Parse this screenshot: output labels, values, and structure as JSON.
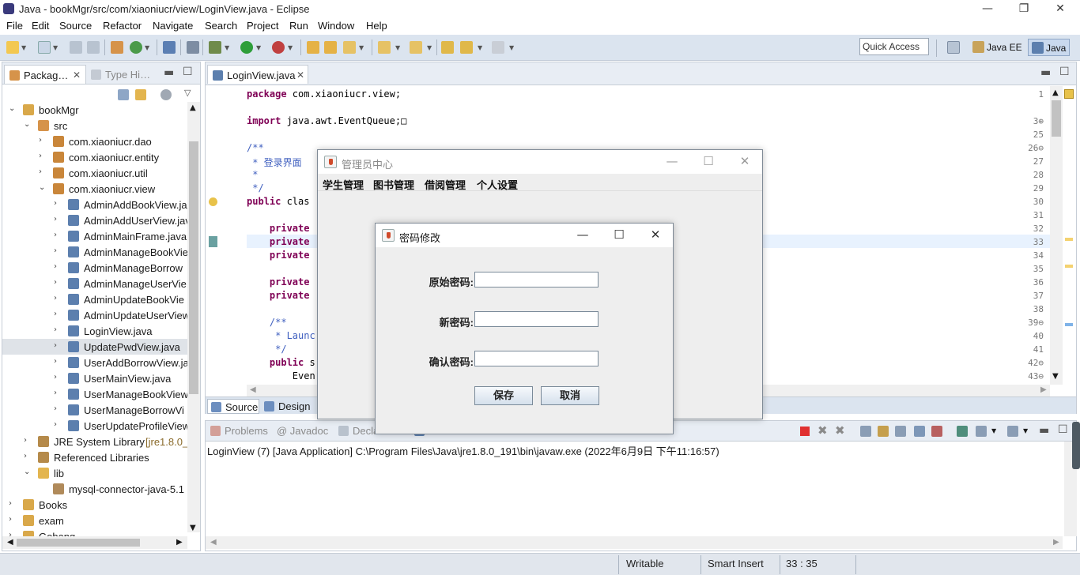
{
  "window": {
    "title": "Java - bookMgr/src/com/xiaoniucr/view/LoginView.java - Eclipse",
    "minimize": "—",
    "restore": "❐",
    "close": "✕"
  },
  "menubar": {
    "items": [
      "File",
      "Edit",
      "Source",
      "Refactor",
      "Navigate",
      "Search",
      "Project",
      "Run",
      "Window",
      "Help"
    ]
  },
  "toolbar": {
    "quick_access": "Quick Access",
    "perspectives": [
      "Java EE",
      "Java"
    ]
  },
  "package_explorer": {
    "tabs": [
      "Packag…",
      "Type Hi…"
    ],
    "tree": [
      {
        "label": "bookMgr",
        "level": 0,
        "twisty": "open",
        "icon": "project-icon"
      },
      {
        "label": "src",
        "level": 1,
        "twisty": "open",
        "icon": "source-folder-icon"
      },
      {
        "label": "com.xiaoniucr.dao",
        "level": 2,
        "twisty": "closed",
        "icon": "package-icon"
      },
      {
        "label": "com.xiaoniucr.entity",
        "level": 2,
        "twisty": "closed",
        "icon": "package-icon"
      },
      {
        "label": "com.xiaoniucr.util",
        "level": 2,
        "twisty": "closed",
        "icon": "package-icon"
      },
      {
        "label": "com.xiaoniucr.view",
        "level": 2,
        "twisty": "open",
        "icon": "package-icon"
      },
      {
        "label": "AdminAddBookView.ja",
        "level": 3,
        "twisty": "closed",
        "icon": "java-file-icon"
      },
      {
        "label": "AdminAddUserView.jav",
        "level": 3,
        "twisty": "closed",
        "icon": "java-file-icon"
      },
      {
        "label": "AdminMainFrame.java",
        "level": 3,
        "twisty": "closed",
        "icon": "java-file-icon"
      },
      {
        "label": "AdminManageBookVie",
        "level": 3,
        "twisty": "closed",
        "icon": "java-file-icon"
      },
      {
        "label": "AdminManageBorrow",
        "level": 3,
        "twisty": "closed",
        "icon": "java-file-icon"
      },
      {
        "label": "AdminManageUserVie",
        "level": 3,
        "twisty": "closed",
        "icon": "java-file-icon"
      },
      {
        "label": "AdminUpdateBookVie",
        "level": 3,
        "twisty": "closed",
        "icon": "java-file-icon"
      },
      {
        "label": "AdminUpdateUserView",
        "level": 3,
        "twisty": "closed",
        "icon": "java-file-icon"
      },
      {
        "label": "LoginView.java",
        "level": 3,
        "twisty": "closed",
        "icon": "java-file-icon"
      },
      {
        "label": "UpdatePwdView.java",
        "level": 3,
        "twisty": "closed",
        "icon": "java-file-icon",
        "selected": true
      },
      {
        "label": "UserAddBorrowView.ja",
        "level": 3,
        "twisty": "closed",
        "icon": "java-file-icon"
      },
      {
        "label": "UserMainView.java",
        "level": 3,
        "twisty": "closed",
        "icon": "java-file-icon"
      },
      {
        "label": "UserManageBookView",
        "level": 3,
        "twisty": "closed",
        "icon": "java-file-icon"
      },
      {
        "label": "UserManageBorrowVi",
        "level": 3,
        "twisty": "closed",
        "icon": "java-file-icon"
      },
      {
        "label": "UserUpdateProfileView",
        "level": 3,
        "twisty": "closed",
        "icon": "java-file-icon"
      },
      {
        "label": "JRE System Library",
        "decoration": "[jre1.8.0_",
        "level": 1,
        "twisty": "closed",
        "icon": "library-icon"
      },
      {
        "label": "Referenced Libraries",
        "level": 1,
        "twisty": "closed",
        "icon": "library-icon"
      },
      {
        "label": "lib",
        "level": 1,
        "twisty": "open",
        "icon": "folder-icon"
      },
      {
        "label": "mysql-connector-java-5.1",
        "level": 2,
        "twisty": "none",
        "icon": "jar-icon"
      },
      {
        "label": "Books",
        "level": 0,
        "twisty": "closed",
        "icon": "project-icon"
      },
      {
        "label": "exam",
        "level": 0,
        "twisty": "closed",
        "icon": "project-icon"
      },
      {
        "label": "Gobang",
        "level": 0,
        "twisty": "closed",
        "icon": "project-icon"
      }
    ]
  },
  "editor": {
    "tab": "LoginView.java",
    "bottom_tabs": [
      "Source",
      "Design"
    ],
    "lines": [
      {
        "n": "1",
        "text": "package com.xiaoniucr.view;",
        "kind": "pkg"
      },
      {
        "n": "",
        "text": "",
        "kind": "blank"
      },
      {
        "n": "3⊕",
        "text": "import java.awt.EventQueue;□",
        "kind": "imp"
      },
      {
        "n": "25",
        "text": "",
        "kind": "blank"
      },
      {
        "n": "26⊖",
        "text": "/**",
        "kind": "cm"
      },
      {
        "n": "27",
        "text": " * 登录界面",
        "kind": "cm"
      },
      {
        "n": "28",
        "text": " *",
        "kind": "cm"
      },
      {
        "n": "29",
        "text": " */",
        "kind": "cm"
      },
      {
        "n": "30",
        "text": "public clas",
        "kind": "pub"
      },
      {
        "n": "31",
        "text": "",
        "kind": "blank"
      },
      {
        "n": "32",
        "text": "    private",
        "kind": "kw"
      },
      {
        "n": "33",
        "text": "    private",
        "kind": "kw"
      },
      {
        "n": "34",
        "text": "    private",
        "kind": "kw"
      },
      {
        "n": "35",
        "text": "",
        "kind": "blank"
      },
      {
        "n": "36",
        "text": "    private",
        "kind": "kw"
      },
      {
        "n": "37",
        "text": "    private",
        "kind": "kw"
      },
      {
        "n": "38",
        "text": "",
        "kind": "blank"
      },
      {
        "n": "39⊖",
        "text": "    /**",
        "kind": "cm"
      },
      {
        "n": "40",
        "text": "     * Launc",
        "kind": "cm"
      },
      {
        "n": "41",
        "text": "     */",
        "kind": "cm"
      },
      {
        "n": "42⊖",
        "text": "    public s",
        "kind": "pub"
      },
      {
        "n": "43⊖",
        "text": "        Even",
        "kind": "plain"
      }
    ]
  },
  "console": {
    "tabs": [
      "Problems",
      "@ Javadoc",
      "Decla",
      "Console"
    ],
    "line": "LoginView (7) [Java Application] C:\\Program Files\\Java\\jre1.8.0_191\\bin\\javaw.exe (2022年6月9日 下午11:16:57)"
  },
  "statusbar": {
    "writable": "Writable",
    "insert_mode": "Smart Insert",
    "position": "33 : 35"
  },
  "admin_window": {
    "title": "管理员中心",
    "menus": [
      "学生管理",
      "图书管理",
      "借阅管理",
      "个人设置"
    ]
  },
  "pwd_dialog": {
    "title": "密码修改",
    "fields": [
      {
        "label": "原始密码:",
        "value": ""
      },
      {
        "label": "新密码:",
        "value": ""
      },
      {
        "label": "确认密码:",
        "value": ""
      }
    ],
    "save": "保存",
    "cancel": "取消"
  },
  "colors": {
    "toolbar_bg": "#dbe4ef",
    "keyword": "#7f0055",
    "comment": "#3f5fbf",
    "current_line": "#e8f2fe",
    "selection": "#dfe3e8"
  }
}
